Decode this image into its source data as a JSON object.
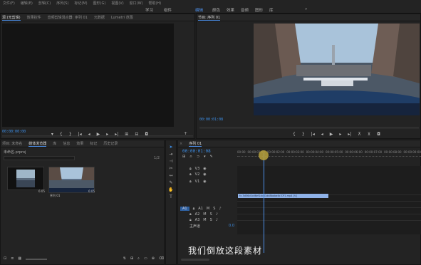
{
  "menu": [
    "文件(F)",
    "编辑(E)",
    "剪辑(C)",
    "序列(S)",
    "标记(M)",
    "图形(G)",
    "视图(V)",
    "窗口(W)",
    "帮助(H)"
  ],
  "workspaces": [
    "学习",
    "组件",
    "编辑",
    "颜色",
    "效果",
    "音频",
    "图形",
    "库"
  ],
  "source": {
    "tabs": [
      "源:(无剪辑)",
      "效果控件",
      "音频剪辑混合器: 序列 01",
      "元数据",
      "Lumetri 范围"
    ],
    "timecode": "00:00:00:00"
  },
  "program": {
    "tab": "节目: 序列 01",
    "timecode": "00:00:01:08"
  },
  "project": {
    "tabs": [
      "项目: 未命名",
      "媒体浏览器",
      "库",
      "信息",
      "效果",
      "标记",
      "历史记录"
    ],
    "path": "未命名.prproj",
    "items": [
      {
        "label": "",
        "duration": "6:05"
      },
      {
        "label": "序列 01",
        "duration": "6:05"
      }
    ]
  },
  "timeline": {
    "tab": "序列 01",
    "timecode": "00:00:01:08",
    "ruler": [
      "00:00",
      "00:00:01:00",
      "00:00:02:00",
      "00:00:03:00",
      "00:00:04:00",
      "00:00:05:00",
      "00:00:06:00",
      "00:00:07:00",
      "00:00:08:00",
      "00:00:09:00"
    ],
    "video_tracks": [
      "V3",
      "V2",
      "V1"
    ],
    "audio_tracks": [
      "A1",
      "A2",
      "A3"
    ],
    "master": "主声道",
    "master_value": "0.0",
    "clip_label": "fx 3d56c0cd6ef1cb61dd8baba6c37f1.mp4 [V]",
    "subtitle": "我们倒放这段素材"
  },
  "colors": {
    "accent": "#4d8fe8",
    "clip": "#8fb2e8",
    "playhead": "#e0c64a"
  }
}
